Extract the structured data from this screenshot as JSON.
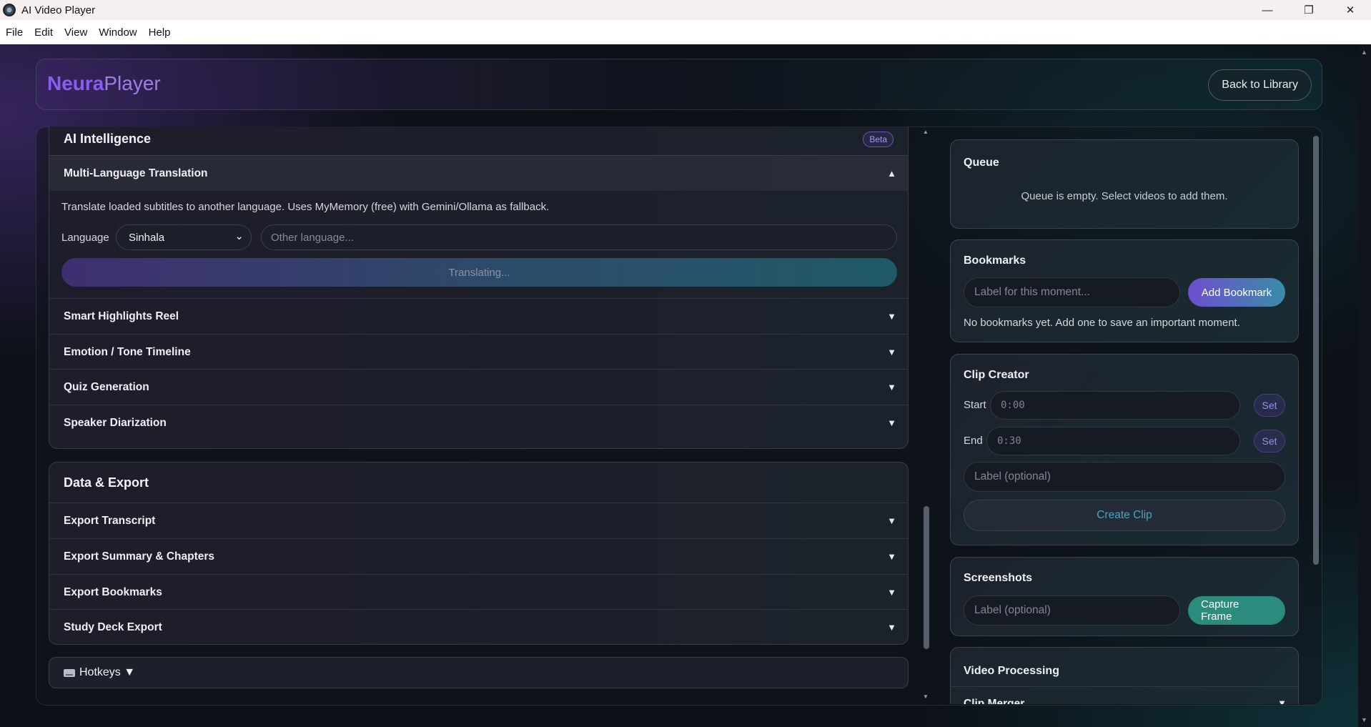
{
  "window": {
    "title": "AI Video Player",
    "controls": {
      "minimize": "—",
      "maximize": "❐",
      "close": "✕"
    }
  },
  "menu": [
    "File",
    "Edit",
    "View",
    "Window",
    "Help"
  ],
  "header": {
    "brand_part1": "Neura",
    "brand_part2": "Player",
    "back_button": "Back to Library"
  },
  "ai_section": {
    "title": "AI Intelligence",
    "badge": "Beta",
    "translation": {
      "title": "Multi-Language Translation",
      "chevron": "▲",
      "description": "Translate loaded subtitles to another language. Uses MyMemory (free) with Gemini/Ollama as fallback.",
      "language_label": "Language",
      "language_selected": "Sinhala",
      "other_placeholder": "Other language...",
      "button": "Translating..."
    },
    "items": [
      {
        "label": "Smart Highlights Reel",
        "chevron": "▼"
      },
      {
        "label": "Emotion / Tone Timeline",
        "chevron": "▼"
      },
      {
        "label": "Quiz Generation",
        "chevron": "▼"
      },
      {
        "label": "Speaker Diarization",
        "chevron": "▼"
      }
    ]
  },
  "export_section": {
    "title": "Data & Export",
    "items": [
      {
        "label": "Export Transcript",
        "chevron": "▼"
      },
      {
        "label": "Export Summary & Chapters",
        "chevron": "▼"
      },
      {
        "label": "Export Bookmarks",
        "chevron": "▼"
      },
      {
        "label": "Study Deck Export",
        "chevron": "▼"
      }
    ]
  },
  "hotkeys": {
    "label": "Hotkeys",
    "chevron": "▼"
  },
  "queue": {
    "title": "Queue",
    "empty": "Queue is empty. Select videos to add them."
  },
  "bookmarks": {
    "title": "Bookmarks",
    "input_placeholder": "Label for this moment...",
    "add_button": "Add Bookmark",
    "empty": "No bookmarks yet. Add one to save an important moment."
  },
  "clip_creator": {
    "title": "Clip Creator",
    "start_label": "Start",
    "start_value": "0:00",
    "end_label": "End",
    "end_value": "0:30",
    "set_label": "Set",
    "label_placeholder": "Label (optional)",
    "create_button": "Create Clip"
  },
  "screenshots": {
    "title": "Screenshots",
    "label_placeholder": "Label (optional)",
    "capture_button": "Capture Frame"
  },
  "video_processing": {
    "title": "Video Processing",
    "item": "Clip Merger",
    "chevron": "▼"
  },
  "colors": {
    "accent_purple": "#8a5cf6",
    "accent_teal": "#2b8c7e",
    "background": "#0c1117"
  }
}
